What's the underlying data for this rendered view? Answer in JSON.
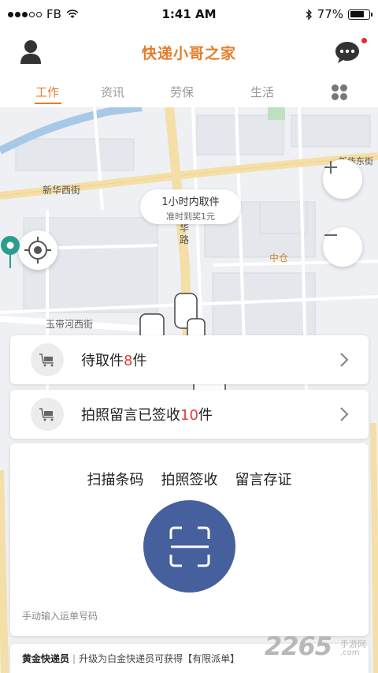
{
  "status_bar": {
    "carrier": "FB",
    "time": "1:41 AM",
    "battery": "77%",
    "battery_level": 0.77
  },
  "header": {
    "title": "快递小哥之家",
    "has_notification": true
  },
  "tabs": [
    {
      "label": "工作",
      "active": true
    },
    {
      "label": "资讯",
      "active": false
    },
    {
      "label": "劳保",
      "active": false
    },
    {
      "label": "生活",
      "active": false
    }
  ],
  "map": {
    "street_labels": [
      "新华西街",
      "玉带河西街",
      "新华东街",
      "中仓"
    ],
    "callout": {
      "title": "1小时内取件",
      "subtitle": "准时到奖1元"
    },
    "road_label_vertical": "华路"
  },
  "rows": [
    {
      "prefix": "待取件",
      "count": "8",
      "suffix": "件"
    },
    {
      "prefix": "拍照留言已签收",
      "count": "10",
      "suffix": "件"
    }
  ],
  "actions": {
    "items": [
      "扫描条码",
      "拍照签收",
      "留言存证"
    ],
    "manual_input": "手动输入运单号码"
  },
  "footer": {
    "level": "黄金快递员",
    "message": "升级为白金快递员可获得【有限派单】"
  },
  "watermark": {
    "brand": "2265",
    "name": "手游网",
    "url": ".com"
  },
  "colors": {
    "accent": "#e47d2b",
    "scan_button": "#45609c",
    "pin": "#2a9d8f",
    "count": "#e43a3a"
  }
}
